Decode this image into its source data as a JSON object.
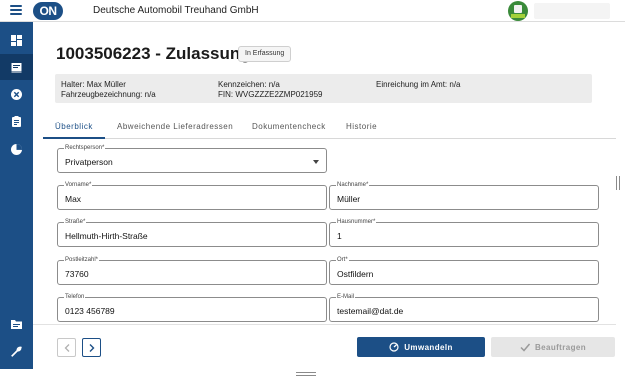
{
  "header": {
    "logo_text": "ON",
    "company_name": "Deutsche Automobil Treuhand GmbH"
  },
  "sidebar": {
    "items": [
      {
        "icon": "dashboard-icon"
      },
      {
        "icon": "vehicle-registration-icon",
        "active": true
      },
      {
        "icon": "cancel-circle-icon"
      },
      {
        "icon": "clipboard-icon"
      },
      {
        "icon": "pie-chart-icon"
      },
      {
        "icon": "folder-icon"
      },
      {
        "icon": "wrench-icon"
      }
    ]
  },
  "page": {
    "title": "1003506223 - Zulassung",
    "status": "In Erfassung"
  },
  "info": {
    "holder": "Halter: Max Müller",
    "vehicle": "Fahrzeugbezeichnung: n/a",
    "plate": "Kennzeichen: n/a",
    "vin": "FIN: WVGZZZE2ZMP021959",
    "submission": "Einreichung im Amt: n/a"
  },
  "tabs": [
    "Überblick",
    "Abweichende Lieferadressen",
    "Dokumentencheck",
    "Historie"
  ],
  "form": {
    "legal_person": {
      "label": "Rechtsperson*",
      "value": "Privatperson"
    },
    "first_name": {
      "label": "Vorname*",
      "value": "Max"
    },
    "last_name": {
      "label": "Nachname*",
      "value": "Müller"
    },
    "street": {
      "label": "Straße*",
      "value": "Hellmuth-Hirth-Straße"
    },
    "house_number": {
      "label": "Hausnummer*",
      "value": "1"
    },
    "postal_code": {
      "label": "Postleitzahl*",
      "value": "73760"
    },
    "city": {
      "label": "Ort*",
      "value": "Ostfildern"
    },
    "phone": {
      "label": "Telefon",
      "value": "0123 456789"
    },
    "email": {
      "label": "E-Mail",
      "value": "testemail@dat.de"
    }
  },
  "actions": {
    "convert": "Umwandeln",
    "commission": "Beauftragen"
  },
  "colors": {
    "brand": "#1c4f86",
    "sidebar_active": "#123a66",
    "disabled_button": "#e6e6e6"
  }
}
